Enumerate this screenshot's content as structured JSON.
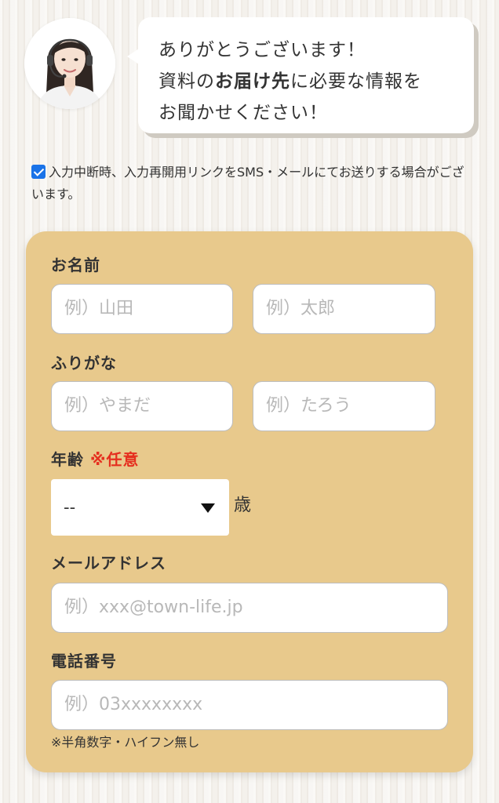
{
  "header": {
    "avatar_icon": "operator-headset-avatar-icon",
    "bubble_line1": "ありがとうございます！",
    "bubble_line2_pre": "資料の",
    "bubble_line2_bold": "お届け先",
    "bubble_line2_post": "に必要な情報を",
    "bubble_line3": "お聞かせください！"
  },
  "notice": {
    "checked": true,
    "text": "入力中断時、入力再開用リンクをSMS・メールにてお送りする場合がございます。"
  },
  "form": {
    "name": {
      "label": "お名前",
      "last_placeholder": "例）山田",
      "first_placeholder": "例）太郎"
    },
    "furigana": {
      "label": "ふりがな",
      "last_placeholder": "例）やまだ",
      "first_placeholder": "例）たろう"
    },
    "age": {
      "label": "年齢",
      "optional": "※任意",
      "selected": "--",
      "unit": "歳"
    },
    "email": {
      "label": "メールアドレス",
      "placeholder": "例）xxx@town-life.jp"
    },
    "phone": {
      "label": "電話番号",
      "placeholder": "例）03xxxxxxxx",
      "hint": "※半角数字・ハイフン無し"
    }
  },
  "colors": {
    "panel": "#e8c98c",
    "optional": "#e52f1f",
    "checkbox": "#1a73e8"
  }
}
